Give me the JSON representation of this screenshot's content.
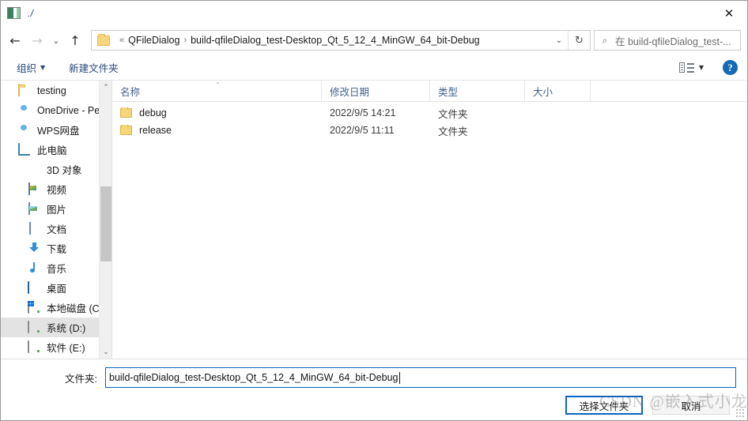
{
  "window": {
    "title": "./",
    "close_label": "✕",
    "icon": "qt-window-icon"
  },
  "nav": {
    "back": "←",
    "forward": "→",
    "recent": "⌄",
    "up": "↑",
    "breadcrumb": {
      "overflow": "«",
      "separator": "›",
      "items": [
        "QFileDialog",
        "build-qfileDialog_test-Desktop_Qt_5_12_4_MinGW_64_bit-Debug"
      ]
    },
    "dropdown": "⌄",
    "refresh": "↻",
    "search_placeholder": "在 build-qfileDialog_test-...",
    "search_icon": "⌕"
  },
  "toolbar": {
    "organize": "组织",
    "organize_caret": "▼",
    "new_folder": "新建文件夹",
    "view_caret": "▼",
    "help": "?"
  },
  "sidebar": {
    "items": [
      {
        "label": "testing",
        "icon": "folder-icon",
        "indent": false,
        "selected": false
      },
      {
        "label": "OneDrive - Pers",
        "icon": "cloud-icon",
        "indent": false,
        "selected": false
      },
      {
        "label": "WPS网盘",
        "icon": "wps-cloud-icon",
        "indent": false,
        "selected": false
      },
      {
        "label": "此电脑",
        "icon": "this-pc-icon",
        "indent": false,
        "selected": false
      },
      {
        "label": "3D 对象",
        "icon": "3d-objects-icon",
        "indent": true,
        "selected": false
      },
      {
        "label": "视频",
        "icon": "videos-icon",
        "indent": true,
        "selected": false
      },
      {
        "label": "图片",
        "icon": "pictures-icon",
        "indent": true,
        "selected": false
      },
      {
        "label": "文档",
        "icon": "documents-icon",
        "indent": true,
        "selected": false
      },
      {
        "label": "下载",
        "icon": "downloads-icon",
        "indent": true,
        "selected": false
      },
      {
        "label": "音乐",
        "icon": "music-icon",
        "indent": true,
        "selected": false
      },
      {
        "label": "桌面",
        "icon": "desktop-icon",
        "indent": true,
        "selected": false
      },
      {
        "label": "本地磁盘 (C:)",
        "icon": "windows-drive-icon",
        "indent": true,
        "selected": false
      },
      {
        "label": "系统 (D:)",
        "icon": "drive-icon",
        "indent": true,
        "selected": true
      },
      {
        "label": "软件 (E:)",
        "icon": "drive-icon",
        "indent": true,
        "selected": false
      }
    ],
    "scroll_up": "⌃",
    "scroll_down": "⌄"
  },
  "file_list": {
    "columns": [
      "名称",
      "修改日期",
      "类型",
      "大小"
    ],
    "sort_indicator": "⌃",
    "rows": [
      {
        "name": "debug",
        "date": "2022/9/5 14:21",
        "type": "文件夹",
        "size": ""
      },
      {
        "name": "release",
        "date": "2022/9/5 11:11",
        "type": "文件夹",
        "size": ""
      }
    ]
  },
  "footer": {
    "folder_label": "文件夹:",
    "folder_value": "build-qfileDialog_test-Desktop_Qt_5_12_4_MinGW_64_bit-Debug",
    "select_button": "选择文件夹",
    "cancel_button": "取消"
  },
  "watermark": "CSDN @嵌入式小龙",
  "colors": {
    "accent": "#0a64c0",
    "link": "#26497a",
    "folder": "#f6d67a",
    "selection": "#e3e3e3",
    "help": "#1569b5"
  }
}
